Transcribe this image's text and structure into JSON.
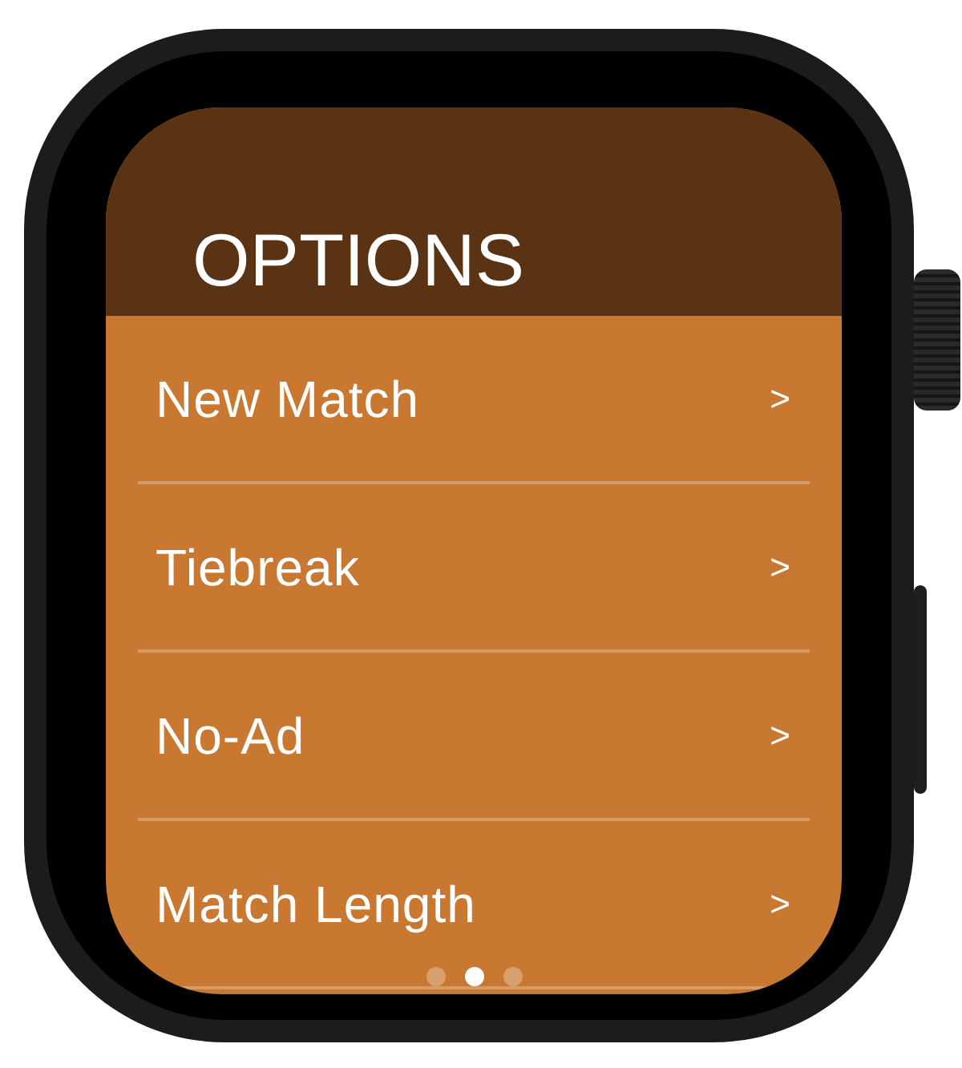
{
  "screen": {
    "title": "OPTIONS"
  },
  "rows": [
    {
      "label": "New Match",
      "chevron": ">"
    },
    {
      "label": "Tiebreak",
      "chevron": ">"
    },
    {
      "label": "No-Ad",
      "chevron": ">"
    },
    {
      "label": "Match Length",
      "chevron": ">"
    }
  ],
  "page_dots": [
    {
      "selected": false
    },
    {
      "selected": true
    },
    {
      "selected": false
    }
  ]
}
